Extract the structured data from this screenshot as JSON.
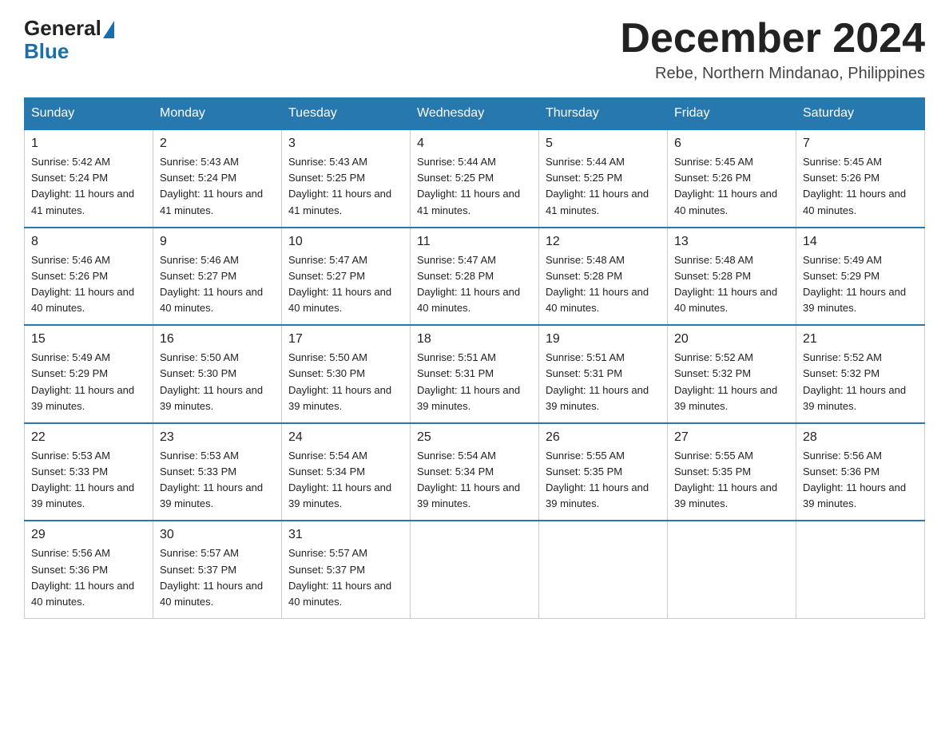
{
  "header": {
    "logo_general": "General",
    "logo_blue": "Blue",
    "month_title": "December 2024",
    "location": "Rebe, Northern Mindanao, Philippines"
  },
  "days_of_week": [
    "Sunday",
    "Monday",
    "Tuesday",
    "Wednesday",
    "Thursday",
    "Friday",
    "Saturday"
  ],
  "weeks": [
    [
      {
        "num": "1",
        "sunrise": "5:42 AM",
        "sunset": "5:24 PM",
        "daylight": "11 hours and 41 minutes."
      },
      {
        "num": "2",
        "sunrise": "5:43 AM",
        "sunset": "5:24 PM",
        "daylight": "11 hours and 41 minutes."
      },
      {
        "num": "3",
        "sunrise": "5:43 AM",
        "sunset": "5:25 PM",
        "daylight": "11 hours and 41 minutes."
      },
      {
        "num": "4",
        "sunrise": "5:44 AM",
        "sunset": "5:25 PM",
        "daylight": "11 hours and 41 minutes."
      },
      {
        "num": "5",
        "sunrise": "5:44 AM",
        "sunset": "5:25 PM",
        "daylight": "11 hours and 41 minutes."
      },
      {
        "num": "6",
        "sunrise": "5:45 AM",
        "sunset": "5:26 PM",
        "daylight": "11 hours and 40 minutes."
      },
      {
        "num": "7",
        "sunrise": "5:45 AM",
        "sunset": "5:26 PM",
        "daylight": "11 hours and 40 minutes."
      }
    ],
    [
      {
        "num": "8",
        "sunrise": "5:46 AM",
        "sunset": "5:26 PM",
        "daylight": "11 hours and 40 minutes."
      },
      {
        "num": "9",
        "sunrise": "5:46 AM",
        "sunset": "5:27 PM",
        "daylight": "11 hours and 40 minutes."
      },
      {
        "num": "10",
        "sunrise": "5:47 AM",
        "sunset": "5:27 PM",
        "daylight": "11 hours and 40 minutes."
      },
      {
        "num": "11",
        "sunrise": "5:47 AM",
        "sunset": "5:28 PM",
        "daylight": "11 hours and 40 minutes."
      },
      {
        "num": "12",
        "sunrise": "5:48 AM",
        "sunset": "5:28 PM",
        "daylight": "11 hours and 40 minutes."
      },
      {
        "num": "13",
        "sunrise": "5:48 AM",
        "sunset": "5:28 PM",
        "daylight": "11 hours and 40 minutes."
      },
      {
        "num": "14",
        "sunrise": "5:49 AM",
        "sunset": "5:29 PM",
        "daylight": "11 hours and 39 minutes."
      }
    ],
    [
      {
        "num": "15",
        "sunrise": "5:49 AM",
        "sunset": "5:29 PM",
        "daylight": "11 hours and 39 minutes."
      },
      {
        "num": "16",
        "sunrise": "5:50 AM",
        "sunset": "5:30 PM",
        "daylight": "11 hours and 39 minutes."
      },
      {
        "num": "17",
        "sunrise": "5:50 AM",
        "sunset": "5:30 PM",
        "daylight": "11 hours and 39 minutes."
      },
      {
        "num": "18",
        "sunrise": "5:51 AM",
        "sunset": "5:31 PM",
        "daylight": "11 hours and 39 minutes."
      },
      {
        "num": "19",
        "sunrise": "5:51 AM",
        "sunset": "5:31 PM",
        "daylight": "11 hours and 39 minutes."
      },
      {
        "num": "20",
        "sunrise": "5:52 AM",
        "sunset": "5:32 PM",
        "daylight": "11 hours and 39 minutes."
      },
      {
        "num": "21",
        "sunrise": "5:52 AM",
        "sunset": "5:32 PM",
        "daylight": "11 hours and 39 minutes."
      }
    ],
    [
      {
        "num": "22",
        "sunrise": "5:53 AM",
        "sunset": "5:33 PM",
        "daylight": "11 hours and 39 minutes."
      },
      {
        "num": "23",
        "sunrise": "5:53 AM",
        "sunset": "5:33 PM",
        "daylight": "11 hours and 39 minutes."
      },
      {
        "num": "24",
        "sunrise": "5:54 AM",
        "sunset": "5:34 PM",
        "daylight": "11 hours and 39 minutes."
      },
      {
        "num": "25",
        "sunrise": "5:54 AM",
        "sunset": "5:34 PM",
        "daylight": "11 hours and 39 minutes."
      },
      {
        "num": "26",
        "sunrise": "5:55 AM",
        "sunset": "5:35 PM",
        "daylight": "11 hours and 39 minutes."
      },
      {
        "num": "27",
        "sunrise": "5:55 AM",
        "sunset": "5:35 PM",
        "daylight": "11 hours and 39 minutes."
      },
      {
        "num": "28",
        "sunrise": "5:56 AM",
        "sunset": "5:36 PM",
        "daylight": "11 hours and 39 minutes."
      }
    ],
    [
      {
        "num": "29",
        "sunrise": "5:56 AM",
        "sunset": "5:36 PM",
        "daylight": "11 hours and 40 minutes."
      },
      {
        "num": "30",
        "sunrise": "5:57 AM",
        "sunset": "5:37 PM",
        "daylight": "11 hours and 40 minutes."
      },
      {
        "num": "31",
        "sunrise": "5:57 AM",
        "sunset": "5:37 PM",
        "daylight": "11 hours and 40 minutes."
      },
      null,
      null,
      null,
      null
    ]
  ]
}
